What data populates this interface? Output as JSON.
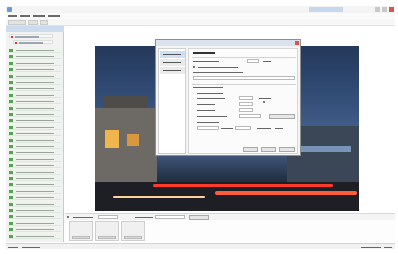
{
  "window": {
    "app_icon": "app-icon",
    "logo": "brand-logo",
    "min_icon": "minimize-icon",
    "max_icon": "maximize-icon",
    "close_icon": "close-icon"
  },
  "menubar": {
    "items": [
      {},
      {},
      {},
      {}
    ]
  },
  "toolbar": {
    "buttons": [
      {},
      {},
      {}
    ]
  },
  "left_panel": {
    "tree_nodes": [
      {},
      {}
    ],
    "camera_rows": 30
  },
  "main": {
    "view": "camera-preview",
    "dialog": {
      "title": "",
      "nav_items": [
        {},
        {},
        {}
      ]
    }
  },
  "bottom_bar": {},
  "bottom_panel": {
    "thumbnails": 3
  },
  "statusbar": {},
  "colors": {
    "accent": "#6b9bd1",
    "close_red": "#d9534f",
    "online_green": "#4fa84f",
    "dialog_bg": "#f4f4f4"
  }
}
